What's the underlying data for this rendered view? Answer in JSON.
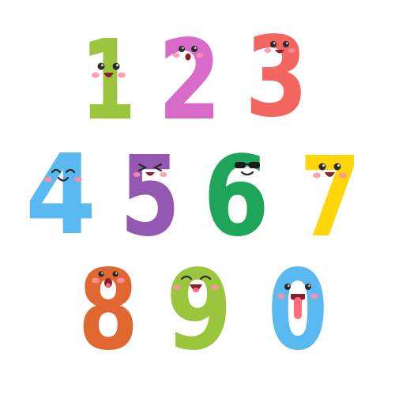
{
  "digits": [
    {
      "label": "1",
      "color": "#9bc53d",
      "face": "happy-open"
    },
    {
      "label": "2",
      "color": "#d96bc8",
      "face": "smile-open"
    },
    {
      "label": "3",
      "color": "#f2665f",
      "face": "smile-open"
    },
    {
      "label": "4",
      "color": "#59b9f0",
      "face": "closed-eyes-smile"
    },
    {
      "label": "5",
      "color": "#9558b2",
      "face": "squint-grin"
    },
    {
      "label": "6",
      "color": "#1fa55a",
      "face": "sunglasses"
    },
    {
      "label": "7",
      "color": "#ffd60a",
      "face": "happy-open"
    },
    {
      "label": "8",
      "color": "#e0672f",
      "face": "surprised"
    },
    {
      "label": "9",
      "color": "#9bc53d",
      "face": "closed-eyes-tongue"
    },
    {
      "label": "0",
      "color": "#59b9f0",
      "face": "tongue-out"
    }
  ]
}
